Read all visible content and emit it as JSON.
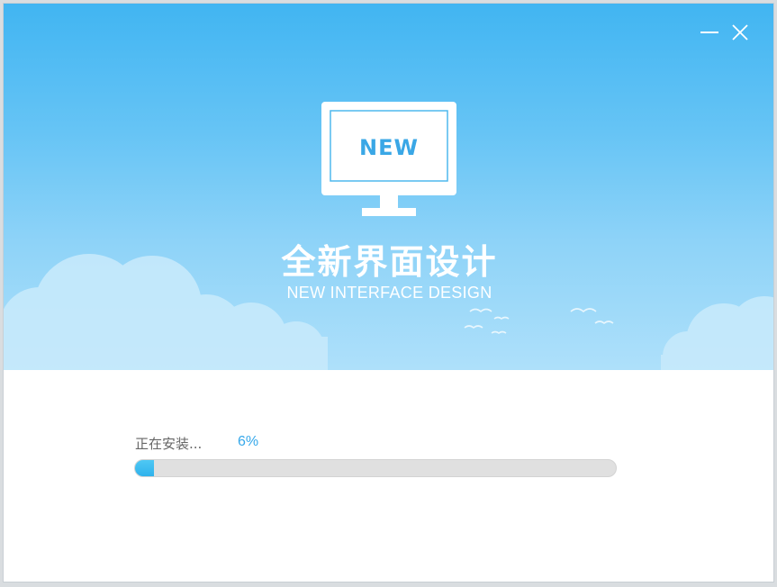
{
  "window": {
    "minimize_icon": "minimize-icon",
    "close_icon": "close-icon"
  },
  "hero": {
    "monitor_text": "NEW",
    "title_cn": "全新界面设计",
    "title_en": "NEW INTERFACE DESIGN",
    "colors": {
      "sky_top": "#41b5f2",
      "sky_bottom": "#aee0fa",
      "accent": "#36a8ea"
    }
  },
  "progress": {
    "label": "正在安装...",
    "percent_text": "6%",
    "value": 0.04
  }
}
